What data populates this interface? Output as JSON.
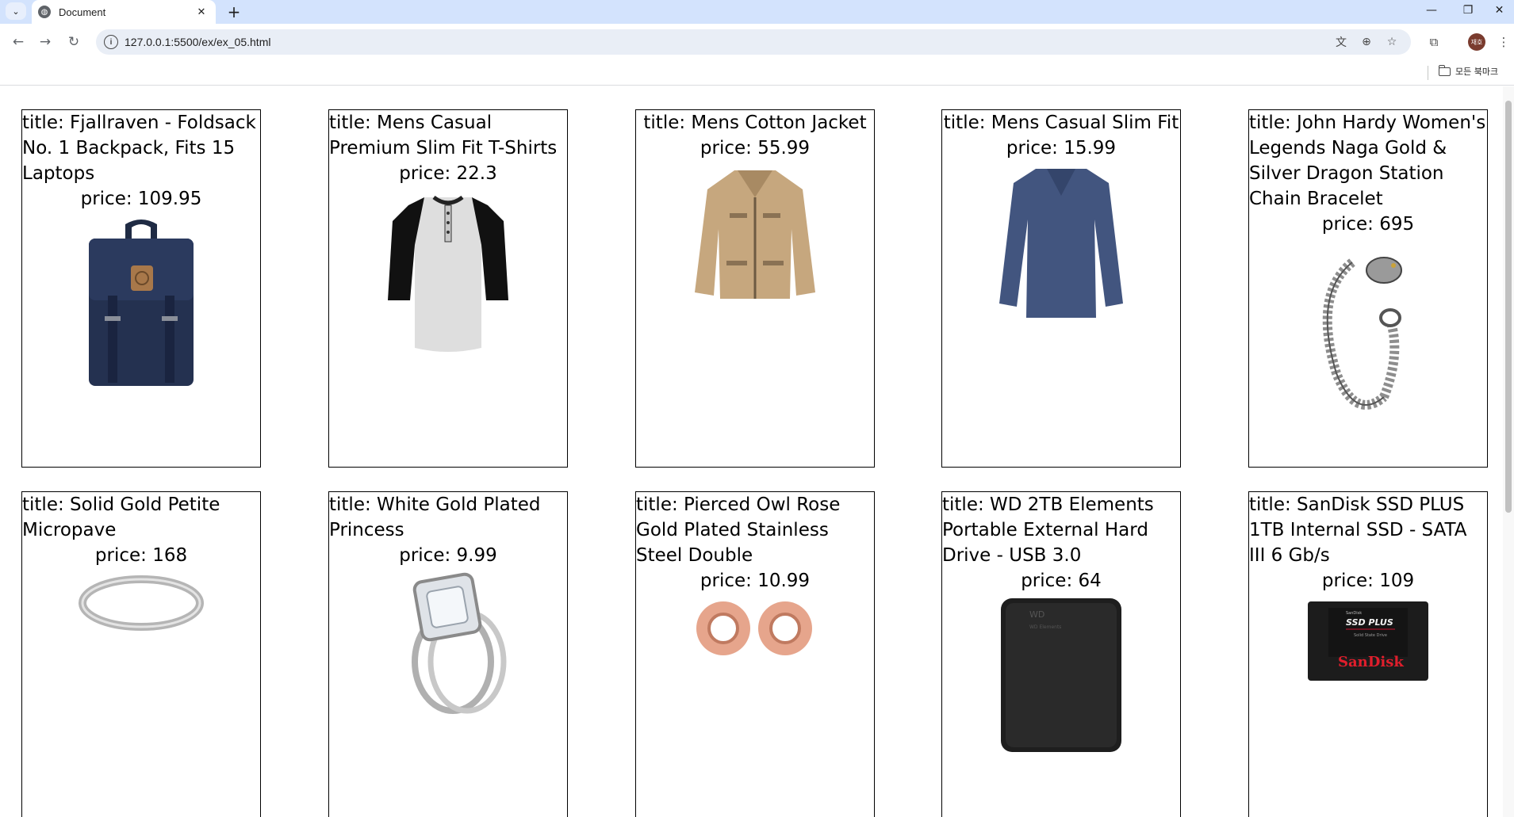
{
  "browser": {
    "tab_title": "Document",
    "url": "127.0.0.1:5500/ex/ex_05.html",
    "bookmarks_all_label": "모든 북마크",
    "profile_initials": "재호"
  },
  "products": [
    {
      "title_text": "title: Fjallraven - Foldsack No. 1 Backpack, Fits 15 Laptops",
      "price_text": "price: 109.95",
      "image": "backpack-image"
    },
    {
      "title_text": "title: Mens Casual Premium Slim Fit T-Shirts",
      "price_text": "price: 22.3",
      "image": "tshirt-image"
    },
    {
      "title_text": "title: Mens Cotton Jacket",
      "price_text": "price: 55.99",
      "image": "jacket-image"
    },
    {
      "title_text": "title: Mens Casual Slim Fit",
      "price_text": "price: 15.99",
      "image": "longsleeve-image"
    },
    {
      "title_text": "title: John Hardy Women's Legends Naga Gold & Silver Dragon Station Chain Bracelet",
      "price_text": "price: 695",
      "image": "bracelet-image"
    },
    {
      "title_text": "title: Solid Gold Petite Micropave",
      "price_text": "price: 168",
      "image": "ring-image"
    },
    {
      "title_text": "title: White Gold Plated Princess",
      "price_text": "price: 9.99",
      "image": "diamond-ring-image"
    },
    {
      "title_text": "title: Pierced Owl Rose Gold Plated Stainless Steel Double",
      "price_text": "price: 10.99",
      "image": "tunnel-plugs-image"
    },
    {
      "title_text": "title: WD 2TB Elements Portable External Hard Drive - USB 3.0",
      "price_text": "price: 64",
      "image": "hard-drive-image"
    },
    {
      "title_text": "title: SanDisk SSD PLUS 1TB Internal SSD - SATA III 6 Gb/s",
      "price_text": "price: 109",
      "image": "ssd-image"
    }
  ],
  "ssd_label": {
    "line1": "SanDisk",
    "line2": "SSD PLUS",
    "line3": "Solid State Drive",
    "brand": "SanDisk"
  },
  "hdd_label": {
    "logo": "WD",
    "line": "WD Elements"
  },
  "colors": {
    "tab_strip": "#d3e3fd",
    "omnibox": "#e9eef6",
    "card_border": "#000000"
  }
}
